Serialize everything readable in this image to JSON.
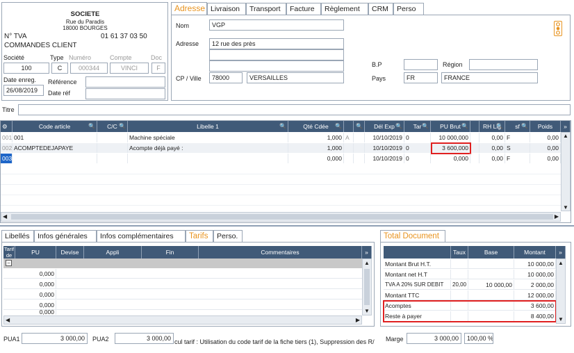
{
  "company": {
    "name": "SOCIETE",
    "street": "Rue du Paradis",
    "city": "18000 BOURGES",
    "tva_label": "N° TVA",
    "phone": "01 61 37 03 50",
    "doc_title": "COMMANDES CLIENT"
  },
  "doc_fields": {
    "societe_label": "Société",
    "type_label": "Type",
    "numero_label": "Numéro",
    "compte_label": "Compte",
    "doc_label": "Doc",
    "societe": "100",
    "type": "C",
    "numero": "000344",
    "compte": "VINCI",
    "doc": "F",
    "date_label": "Date enreg.",
    "date": "26/08/2019",
    "reference_label": "Référence",
    "date_ref_label": "Date réf",
    "reference": "",
    "date_ref": ""
  },
  "top_tabs": [
    "Adresse",
    "Livraison",
    "Transport",
    "Facture",
    "Règlement",
    "CRM",
    "Perso"
  ],
  "address": {
    "nom_label": "Nom",
    "nom": "VGP",
    "adresse_label": "Adresse",
    "adresse1": "12 rue des près",
    "adresse2": "",
    "adresse3": "",
    "cp_label": "CP / Ville",
    "cp": "78000",
    "ville": "VERSAILLES",
    "bp_label": "B.P",
    "bp": "",
    "region_label": "Région",
    "region": "",
    "pays_label": "Pays",
    "pays_code": "FR",
    "pays": "FRANCE"
  },
  "titre_label": "Titre",
  "titre": "",
  "lines_table": {
    "headers": [
      "Code article",
      "C/C",
      "Libelle 1",
      "Qté Cdée",
      "Dél Exp",
      "Tar",
      "PU Brut",
      "RH Lig",
      "sf",
      "Poids"
    ],
    "rows": [
      {
        "n": "001",
        "code": "001",
        "libelle": "Machine spéciale",
        "qte": "1,000",
        "a": "A",
        "del": "10/10/2019",
        "tar": "0",
        "pu": "10 000,000",
        "rh": "0,00",
        "sf": "F",
        "poids": "0,00"
      },
      {
        "n": "002",
        "code": "ACOMPTEDEJAPAYE",
        "libelle": "Acompte déjà payé :",
        "qte": "1,000",
        "a": "",
        "del": "10/10/2019",
        "tar": "0",
        "pu": "3 600,000",
        "rh": "0,00",
        "sf": "S",
        "poids": "0,00"
      },
      {
        "n": "003",
        "code": "",
        "libelle": "",
        "qte": "0,000",
        "a": "",
        "del": "10/10/2019",
        "tar": "0",
        "pu": "0,000",
        "rh": "0,00",
        "sf": "F",
        "poids": "0,00"
      }
    ]
  },
  "bottom_tabs": [
    "Libellés",
    "Infos générales",
    "Infos complémentaires",
    "Tarifs",
    "Perso."
  ],
  "tarifs_table": {
    "headers": [
      "Tarif de",
      "PU",
      "Devise",
      "Appli",
      "Fin",
      "Commentaires"
    ],
    "rows": [
      "0,000",
      "0,000",
      "0,000",
      "0,000",
      "0,000"
    ]
  },
  "pua": {
    "pua1_label": "PUA1",
    "pua1": "3 000,00",
    "pua2_label": "PUA2",
    "pua2": "3 000,00",
    "calc_text": "cul tarif : Utilisation du code tarif de la fiche tiers (1), Suppression des R/..."
  },
  "total": {
    "tab": "Total Document",
    "headers": [
      "Taux",
      "Base",
      "Montant"
    ],
    "rows": [
      {
        "label": "Montant Brut H.T.",
        "taux": "",
        "base": "",
        "montant": "10 000,00"
      },
      {
        "label": "Montant net H.T",
        "taux": "",
        "base": "",
        "montant": "10 000,00"
      },
      {
        "label": "TVA A 20% SUR DEBIT",
        "taux": "20,00",
        "base": "10 000,00",
        "montant": "2 000,00"
      },
      {
        "label": "Montant TTC",
        "taux": "",
        "base": "",
        "montant": "12 000,00"
      },
      {
        "label": "Acomptes",
        "taux": "",
        "base": "",
        "montant": "3 600,00"
      },
      {
        "label": "Reste à payer",
        "taux": "",
        "base": "",
        "montant": "8 400,00"
      }
    ],
    "marge_label": "Marge",
    "marge": "3 000,00",
    "marge_pct": "100,00 %"
  },
  "colors": {
    "header_bg": "#405a78",
    "highlight": "#e02020",
    "accent_tab": "#e8931e"
  }
}
